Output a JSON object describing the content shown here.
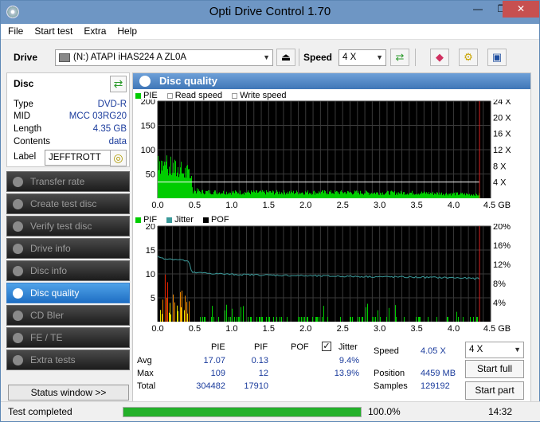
{
  "window": {
    "title": "Opti Drive Control 1.70",
    "minimize": "—",
    "maximize": "❐",
    "close": "✕"
  },
  "menu": [
    "File",
    "Start test",
    "Extra",
    "Help"
  ],
  "toolbar": {
    "drive_label": "Drive",
    "drive_value": "(N:)  ATAPI iHAS224   A ZL0A",
    "speed_label": "Speed",
    "speed_value": "4 X"
  },
  "disc": {
    "header": "Disc",
    "rows": [
      {
        "key": "Type",
        "value": "DVD-R"
      },
      {
        "key": "MID",
        "value": "MCC 03RG20"
      },
      {
        "key": "Length",
        "value": "4.35 GB"
      },
      {
        "key": "Contents",
        "value": "data"
      }
    ],
    "label_key": "Label",
    "label_value": "JEFFTROTT"
  },
  "nav": [
    {
      "label": "Transfer rate",
      "active": false
    },
    {
      "label": "Create test disc",
      "active": false
    },
    {
      "label": "Verify test disc",
      "active": false
    },
    {
      "label": "Drive info",
      "active": false
    },
    {
      "label": "Disc info",
      "active": false
    },
    {
      "label": "Disc quality",
      "active": true
    },
    {
      "label": "CD Bler",
      "active": false
    },
    {
      "label": "FE / TE",
      "active": false
    },
    {
      "label": "Extra tests",
      "active": false
    }
  ],
  "status_window_label": "Status window >>",
  "panel_title": "Disc quality",
  "legend_top": [
    {
      "name": "PIE",
      "color": "#00cc00"
    },
    {
      "name": "Read speed",
      "color": "#ffffff"
    },
    {
      "name": "Write speed",
      "color": "#ffffff"
    }
  ],
  "legend_bottom": [
    {
      "name": "PIF",
      "color": "#00cc00"
    },
    {
      "name": "Jitter",
      "color": "#3b9a9a"
    },
    {
      "name": "POF",
      "color": "#000000"
    }
  ],
  "chart_data": [
    {
      "type": "area",
      "series": [
        {
          "name": "PIE",
          "color": "#00cc00"
        },
        {
          "name": "Read speed",
          "color": "#ffffff"
        }
      ],
      "x_ticks": [
        "0.0",
        "0.5",
        "1.0",
        "1.5",
        "2.0",
        "2.5",
        "3.0",
        "3.5",
        "4.0",
        "4.5 GB"
      ],
      "y_left_ticks": [
        "200",
        "150",
        "100",
        "50"
      ],
      "y_right_ticks": [
        "24 X",
        "20 X",
        "16 X",
        "12 X",
        "8 X",
        "4 X"
      ],
      "xlim": [
        0,
        4.5
      ],
      "ylim": [
        0,
        200
      ],
      "pie_profile": [
        [
          0.0,
          95
        ],
        [
          0.05,
          75
        ],
        [
          0.1,
          70
        ],
        [
          0.2,
          65
        ],
        [
          0.3,
          60
        ],
        [
          0.4,
          55
        ],
        [
          0.45,
          48
        ],
        [
          0.46,
          18
        ],
        [
          0.6,
          14
        ],
        [
          1.0,
          13
        ],
        [
          1.5,
          13
        ],
        [
          2.0,
          13
        ],
        [
          2.5,
          13
        ],
        [
          3.0,
          12
        ],
        [
          3.5,
          12
        ],
        [
          4.0,
          10
        ],
        [
          4.35,
          8
        ]
      ],
      "read_speed": 4,
      "end_marker": 4.35
    },
    {
      "type": "bar",
      "series": [
        {
          "name": "PIF",
          "color": "#00cc00"
        },
        {
          "name": "Jitter",
          "color": "#3b9a9a"
        }
      ],
      "x_ticks": [
        "0.0",
        "0.5",
        "1.0",
        "1.5",
        "2.0",
        "2.5",
        "3.0",
        "3.5",
        "4.0",
        "4.5 GB"
      ],
      "y_left_ticks": [
        "20",
        "15",
        "10",
        "5"
      ],
      "y_right_ticks": [
        "20%",
        "16%",
        "12%",
        "8%",
        "4%"
      ],
      "xlim": [
        0,
        4.5
      ],
      "ylim": [
        0,
        20
      ],
      "y2lim": [
        0,
        20
      ],
      "pif_max": 12,
      "jitter_profile": [
        [
          0.0,
          13.6
        ],
        [
          0.1,
          13.2
        ],
        [
          0.3,
          13.0
        ],
        [
          0.42,
          12.6
        ],
        [
          0.46,
          10.3
        ],
        [
          1.0,
          9.9
        ],
        [
          2.0,
          9.6
        ],
        [
          3.0,
          9.4
        ],
        [
          4.0,
          9.2
        ],
        [
          4.35,
          9.0
        ]
      ],
      "end_marker": 4.35
    }
  ],
  "stats": {
    "headers": {
      "pie": "PIE",
      "pif": "PIF",
      "pof": "POF",
      "jitter": "Jitter"
    },
    "rows": [
      {
        "label": "Avg",
        "pie": "17.07",
        "pif": "0.13",
        "jitter": "9.4%"
      },
      {
        "label": "Max",
        "pie": "109",
        "pif": "12",
        "jitter": "13.9%"
      },
      {
        "label": "Total",
        "pie": "304482",
        "pif": "17910",
        "jitter": ""
      }
    ],
    "jitter_checked": true,
    "speed_label": "Speed",
    "speed_value": "4.05 X",
    "position_label": "Position",
    "position_value": "4459 MB",
    "samples_label": "Samples",
    "samples_value": "129192",
    "speed_select": "4 X",
    "start_full": "Start full",
    "start_part": "Start part"
  },
  "status": {
    "text": "Test completed",
    "progress": 100,
    "progress_text": "100.0%",
    "time": "14:32"
  }
}
